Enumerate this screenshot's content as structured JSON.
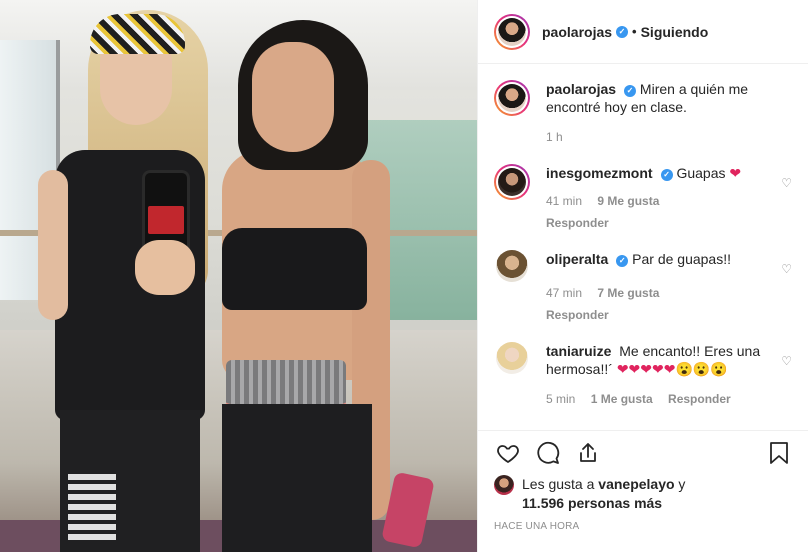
{
  "header": {
    "username": "paolarojas",
    "separator": "•",
    "follow_status": "Siguiendo",
    "more_icon": "more-options-icon"
  },
  "caption": {
    "username": "paolarojas",
    "text": "Miren a quién me encontré hoy en clase.",
    "time": "1 h"
  },
  "comments": [
    {
      "username": "inesgomezmont",
      "verified": true,
      "text": "Guapas ",
      "emoji": "❤",
      "time": "41 min",
      "likes": "9 Me gusta",
      "reply": "Responder"
    },
    {
      "username": "oliperalta",
      "verified": true,
      "text": "Par de guapas!!",
      "time": "47 min",
      "likes": "7 Me gusta",
      "reply": "Responder"
    },
    {
      "username": "taniaruize",
      "verified": false,
      "text": "Me encanto!! Eres una hermosa!!´ ",
      "emoji": "❤❤❤❤❤😮😮😮",
      "time": "5 min",
      "likes": "1 Me gusta",
      "reply": "Responder"
    }
  ],
  "actions": {
    "like_icon": "heart-outline-icon",
    "comment_icon": "comment-icon",
    "share_icon": "share-icon",
    "save_icon": "bookmark-icon"
  },
  "likes": {
    "prefix": "Les gusta a ",
    "user": "vanepelayo",
    "mid": " y",
    "count": "11.596 personas más"
  },
  "posted": "HACE UNA HORA",
  "colors": {
    "verified": "#3897f0",
    "heart": "#e0245e",
    "muted": "#8e8e8e",
    "text": "#262626"
  }
}
